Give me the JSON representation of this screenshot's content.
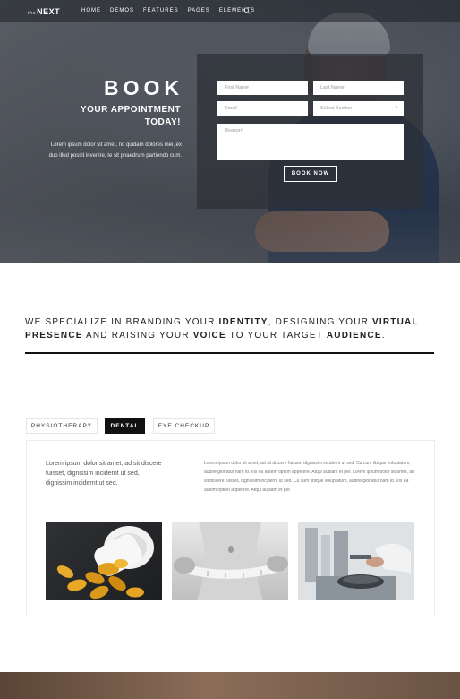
{
  "nav": {
    "logo_prefix": "the",
    "logo_main": "NEXT",
    "items": [
      "HOME",
      "DEMOS",
      "FEATURES",
      "PAGES",
      "ELEMENTS"
    ],
    "search_icon": "search-icon"
  },
  "hero": {
    "title": "BOOK",
    "subtitle_line1": "YOUR APPOINTMENT",
    "subtitle_line2": "TODAY!",
    "description": "Lorem ipsum dolor sit amet, no quidam dolores mei, ex duo illud possit invenire, te sit phaedrum partiendo cum."
  },
  "form": {
    "first_name_placeholder": "First Name",
    "last_name_placeholder": "Last Name",
    "email_placeholder": "Email",
    "section_value": "Select Section",
    "reason_placeholder": "Reason*",
    "submit_label": "BOOK NOW"
  },
  "statement": {
    "part1": "WE SPECIALIZE IN BRANDING YOUR ",
    "bold1": "IDENTITY",
    "part2": ", DESIGNING YOUR ",
    "bold2": "VIRTUAL PRESENCE",
    "part3": " AND RAISING YOUR ",
    "bold3": "VOICE",
    "part4": " TO YOUR TARGET ",
    "bold4": "AUDIENCE",
    "part5": "."
  },
  "tabs": [
    {
      "label": "PHYSIOTHERAPY",
      "active": false
    },
    {
      "label": "DENTAL",
      "active": true
    },
    {
      "label": "EYE CHECKUP",
      "active": false
    }
  ],
  "tab_content": {
    "lead": "Lorem ipsum dolor sit amet, ad sit discere fuisset, dignissim incidernt ut sed, dignissim incidernt ut sed.",
    "body": "Lorem ipsum dolor sit amet, ad sit discere fuisset, dignissim incidernt ut sed. Cu cum tibique voluptatum, audire gloriatur nam id. Vix ea autem option appetere. Atqui audiam et per. Lorem ipsum dolor sit amet, ad sit discere fuisset, dignissim incidernt ut sed. Cu cum tibique voluptatum, audire gloriatur nam id. Vix ea autem option appetere. Atqui audiam et per."
  },
  "colors": {
    "accent_dark": "#111111",
    "form_panel": "#2d3037",
    "text": "#222222"
  }
}
